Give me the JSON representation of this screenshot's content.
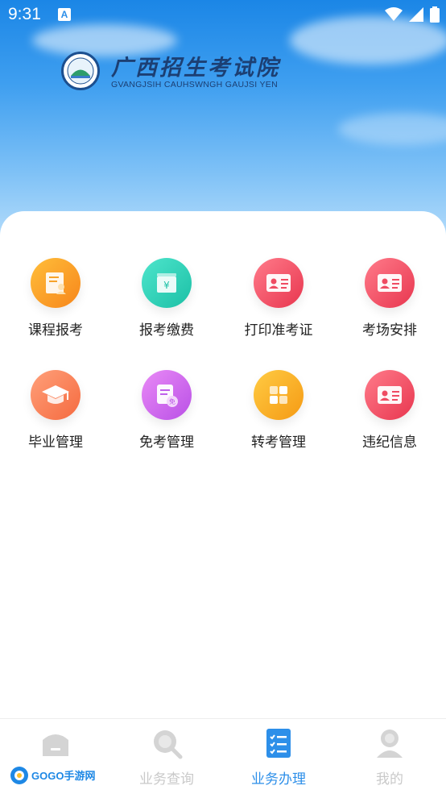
{
  "status_bar": {
    "time": "9:31",
    "notification_badge": "A"
  },
  "header": {
    "title": "广西招生考试院",
    "subtitle": "GVANGJSIH CAUHSWNGH GAUJSI YEN"
  },
  "services": [
    {
      "label": "课程报考",
      "icon": "course-register-icon",
      "color": "#fa9d27"
    },
    {
      "label": "报考缴费",
      "icon": "payment-icon",
      "color": "#2ed1b8"
    },
    {
      "label": "打印准考证",
      "icon": "admission-ticket-icon",
      "color": "#f2556a"
    },
    {
      "label": "考场安排",
      "icon": "exam-room-icon",
      "color": "#f2556a"
    },
    {
      "label": "毕业管理",
      "icon": "graduation-cap-icon",
      "color": "#ff7f55"
    },
    {
      "label": "免考管理",
      "icon": "exemption-icon",
      "color": "#d06bf0"
    },
    {
      "label": "转考管理",
      "icon": "transfer-icon",
      "color": "#fcae26"
    },
    {
      "label": "违纪信息",
      "icon": "violation-info-icon",
      "color": "#f2556a"
    }
  ],
  "tabs": [
    {
      "label": "",
      "icon": "home-icon",
      "active": false
    },
    {
      "label": "业务查询",
      "icon": "search-icon",
      "active": false
    },
    {
      "label": "业务办理",
      "icon": "checklist-icon",
      "active": true
    },
    {
      "label": "我的",
      "icon": "profile-icon",
      "active": false
    }
  ],
  "watermark": {
    "text": "GOGO手游网"
  },
  "colors": {
    "accent": "#2d8fe9",
    "inactive_tab": "#c9c9c9"
  }
}
